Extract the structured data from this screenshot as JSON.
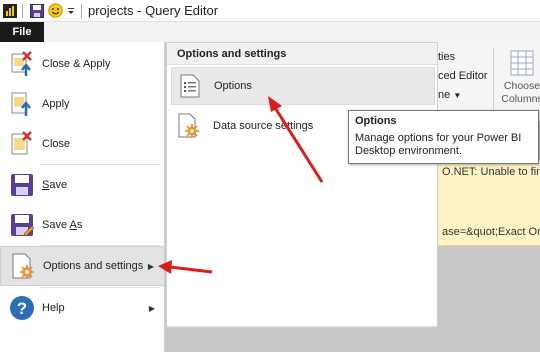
{
  "titlebar": {
    "title": "projects - Query Editor"
  },
  "file_tab": {
    "label": "File"
  },
  "menu": {
    "items": [
      {
        "label": "Close & Apply",
        "icon": "close-apply-icon"
      },
      {
        "label": "Apply",
        "icon": "apply-icon"
      },
      {
        "label": "Close",
        "icon": "close-doc-icon"
      },
      {
        "label": "Save",
        "icon": "save-icon"
      },
      {
        "label": "Save As",
        "icon": "save-as-icon"
      },
      {
        "label": "Options and settings",
        "icon": "options-settings-icon",
        "active": true
      },
      {
        "label": "Help",
        "icon": "help-icon"
      }
    ]
  },
  "submenu": {
    "header": "Options and settings",
    "items": [
      {
        "label": "Options",
        "icon": "options-icon"
      },
      {
        "label": "Data source settings",
        "icon": "data-source-settings-icon"
      }
    ]
  },
  "tooltip": {
    "title": "Options",
    "description_line1": "Manage options for your Power BI",
    "description_line2": "Desktop environment."
  },
  "background": {
    "ribbon_text1": "ties",
    "ribbon_text2": "ced Editor",
    "ribbon_text3": "ne",
    "choose_columns_line1": "Choose",
    "choose_columns_line2": "Columns",
    "error_text1": "O.NET: Unable to find",
    "error_text2": "ase=&quot;Exact Onl"
  },
  "colors": {
    "arrow": "#e01b1b",
    "menu_active": "#e3e3e3",
    "file_tab": "#1a1a1a",
    "tooltip_border": "#767676"
  }
}
